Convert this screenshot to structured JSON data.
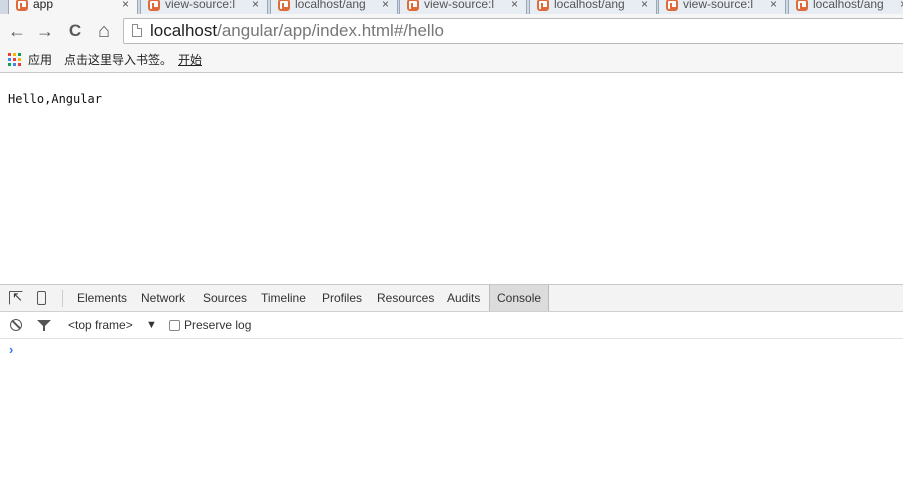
{
  "tabs": [
    {
      "title": "app",
      "close": "×",
      "active": true
    },
    {
      "title": "view-source:l",
      "close": "×",
      "active": false
    },
    {
      "title": "localhost/ang",
      "close": "×",
      "active": false
    },
    {
      "title": "view-source:l",
      "close": "×",
      "active": false
    },
    {
      "title": "localhost/ang",
      "close": "×",
      "active": false
    },
    {
      "title": "view-source:l",
      "close": "×",
      "active": false
    },
    {
      "title": "localhost/ang",
      "close": "×",
      "active": false
    }
  ],
  "toolbar": {
    "back_icon": "←",
    "forward_icon": "→",
    "reload_icon": "C",
    "home_icon": "⌂",
    "url_host": "localhost",
    "url_path": "/angular/app/index.html#/hello"
  },
  "bookmarks": {
    "apps_label": "应用",
    "import_label": "点击这里导入书签。",
    "start_link": "开始"
  },
  "page": {
    "text": "Hello,Angular"
  },
  "devtools": {
    "tabs": [
      "Elements",
      "Network",
      "Sources",
      "Timeline",
      "Profiles",
      "Resources",
      "Audits",
      "Console"
    ],
    "active_tab": "Console",
    "frame_select": "<top frame>",
    "frame_arrow": "▼",
    "preserve_log_label": "Preserve log",
    "preserve_log_checked": false,
    "prompt": "›"
  },
  "colors": {
    "prompt": "#367cf1",
    "favicon": "#e06b3a",
    "apps_grid": [
      "#e44134",
      "#f4b400",
      "#0f9d58",
      "#4285f4",
      "#e44134",
      "#f4b400",
      "#0f9d58",
      "#4285f4",
      "#e44134"
    ]
  }
}
